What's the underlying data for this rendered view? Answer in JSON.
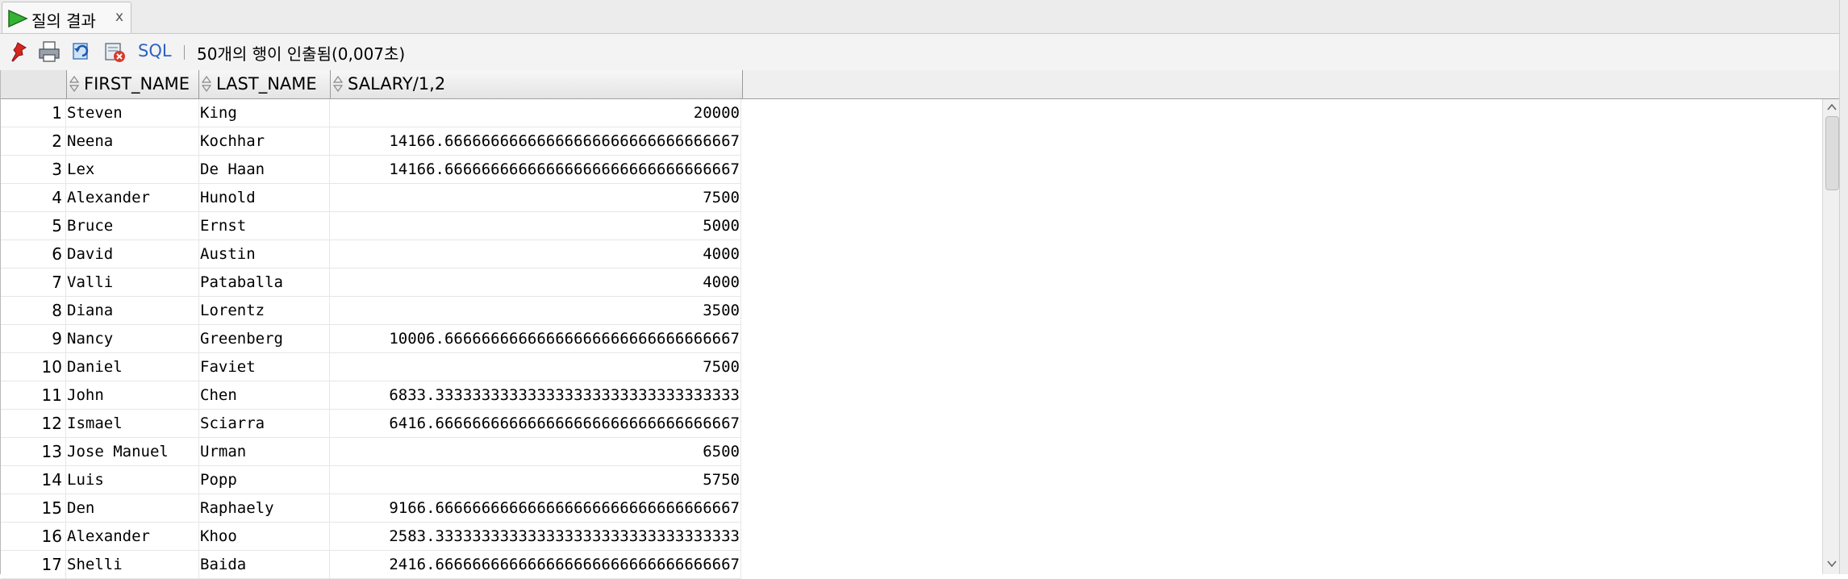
{
  "tab": {
    "label": "질의 결과",
    "close": "x"
  },
  "toolbar": {
    "sql_label": "SQL",
    "status": "50개의 행이 인출됨(0,007초)"
  },
  "grid": {
    "columns": [
      "FIRST_NAME",
      "LAST_NAME",
      "SALARY/1,2"
    ],
    "rows": [
      {
        "num": "1",
        "first": "Steven",
        "last": "King",
        "salary": "20000"
      },
      {
        "num": "2",
        "first": "Neena",
        "last": "Kochhar",
        "salary": "14166.66666666666666666666666666666667"
      },
      {
        "num": "3",
        "first": "Lex",
        "last": "De Haan",
        "salary": "14166.66666666666666666666666666666667"
      },
      {
        "num": "4",
        "first": "Alexander",
        "last": "Hunold",
        "salary": "7500"
      },
      {
        "num": "5",
        "first": "Bruce",
        "last": "Ernst",
        "salary": "5000"
      },
      {
        "num": "6",
        "first": "David",
        "last": "Austin",
        "salary": "4000"
      },
      {
        "num": "7",
        "first": "Valli",
        "last": "Pataballa",
        "salary": "4000"
      },
      {
        "num": "8",
        "first": "Diana",
        "last": "Lorentz",
        "salary": "3500"
      },
      {
        "num": "9",
        "first": "Nancy",
        "last": "Greenberg",
        "salary": "10006.66666666666666666666666666666667"
      },
      {
        "num": "10",
        "first": "Daniel",
        "last": "Faviet",
        "salary": "7500"
      },
      {
        "num": "11",
        "first": "John",
        "last": "Chen",
        "salary": "6833.333333333333333333333333333333333"
      },
      {
        "num": "12",
        "first": "Ismael",
        "last": "Sciarra",
        "salary": "6416.666666666666666666666666666666667"
      },
      {
        "num": "13",
        "first": "Jose Manuel",
        "last": "Urman",
        "salary": "6500"
      },
      {
        "num": "14",
        "first": "Luis",
        "last": "Popp",
        "salary": "5750"
      },
      {
        "num": "15",
        "first": "Den",
        "last": "Raphaely",
        "salary": "9166.666666666666666666666666666666667"
      },
      {
        "num": "16",
        "first": "Alexander",
        "last": "Khoo",
        "salary": "2583.333333333333333333333333333333333"
      },
      {
        "num": "17",
        "first": "Shelli",
        "last": "Baida",
        "salary": "2416.666666666666666666666666666666667"
      }
    ]
  },
  "colors": {
    "accent_link": "#2b62c4",
    "run_icon": "#2e9d2e",
    "pin_icon": "#c8201e"
  },
  "icons": [
    "run-icon",
    "pin-icon",
    "print-icon",
    "refresh-icon",
    "export-icon",
    "sort-icon",
    "scroll-up-icon",
    "scroll-down-icon"
  ]
}
